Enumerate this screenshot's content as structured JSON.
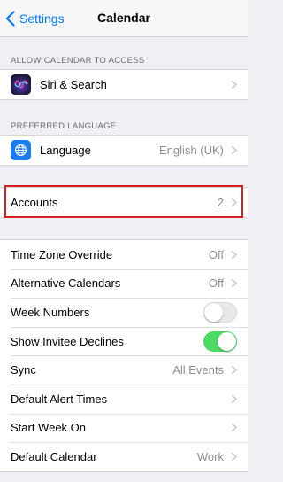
{
  "nav": {
    "back_label": "Settings",
    "title": "Calendar"
  },
  "sections": {
    "access_header": "ALLOW CALENDAR TO ACCESS",
    "language_header": "PREFERRED LANGUAGE"
  },
  "siri": {
    "label": "Siri & Search"
  },
  "language": {
    "label": "Language",
    "value": "English (UK)"
  },
  "accounts": {
    "label": "Accounts",
    "value": "2"
  },
  "settings": {
    "time_zone": {
      "label": "Time Zone Override",
      "value": "Off"
    },
    "alt_calendars": {
      "label": "Alternative Calendars",
      "value": "Off"
    },
    "week_numbers": {
      "label": "Week Numbers",
      "state": "off"
    },
    "invitee_declines": {
      "label": "Show Invitee Declines",
      "state": "on"
    },
    "sync": {
      "label": "Sync",
      "value": "All Events"
    },
    "alert_times": {
      "label": "Default Alert Times"
    },
    "start_week": {
      "label": "Start Week On"
    },
    "default_calendar": {
      "label": "Default Calendar",
      "value": "Work"
    }
  },
  "colors": {
    "accent": "#007aff",
    "toggle_on": "#4cd964",
    "highlight": "#d81d25"
  }
}
